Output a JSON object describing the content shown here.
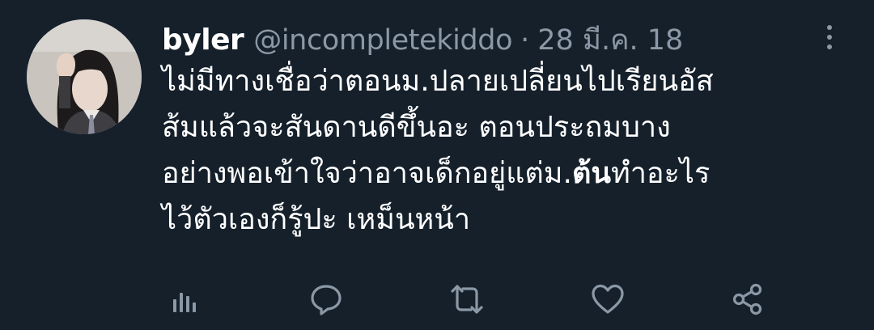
{
  "tweet": {
    "display_name": "byler",
    "handle": "@incompletekiddo",
    "separator": "·",
    "date": "28 มี.ค. 18",
    "text_lines": [
      "ไม่มีทางเชื่อว่าตอนม.ปลายเปลี่ยนไปเรียนอัส",
      "ส้มแล้วจะสันดานดีขึ้นอะ ตอนประถมบาง",
      "อย่างพอเข้าใจว่าอาจเด็กอยู่แต่ม.",
      "ไว้ตัวเองก็รู้ปะ เหม็นหน้า"
    ],
    "bold_word": "ต้น",
    "line3_tail": "ทำอะไร"
  },
  "icons": {
    "avatar": "profile-photo",
    "more": "more-vertical-icon",
    "analytics": "analytics-icon",
    "reply": "reply-icon",
    "retweet": "retweet-icon",
    "like": "like-icon",
    "share": "share-icon"
  },
  "colors": {
    "background": "#15202b",
    "text_primary": "#ffffff",
    "text_secondary": "#8b98a5"
  }
}
